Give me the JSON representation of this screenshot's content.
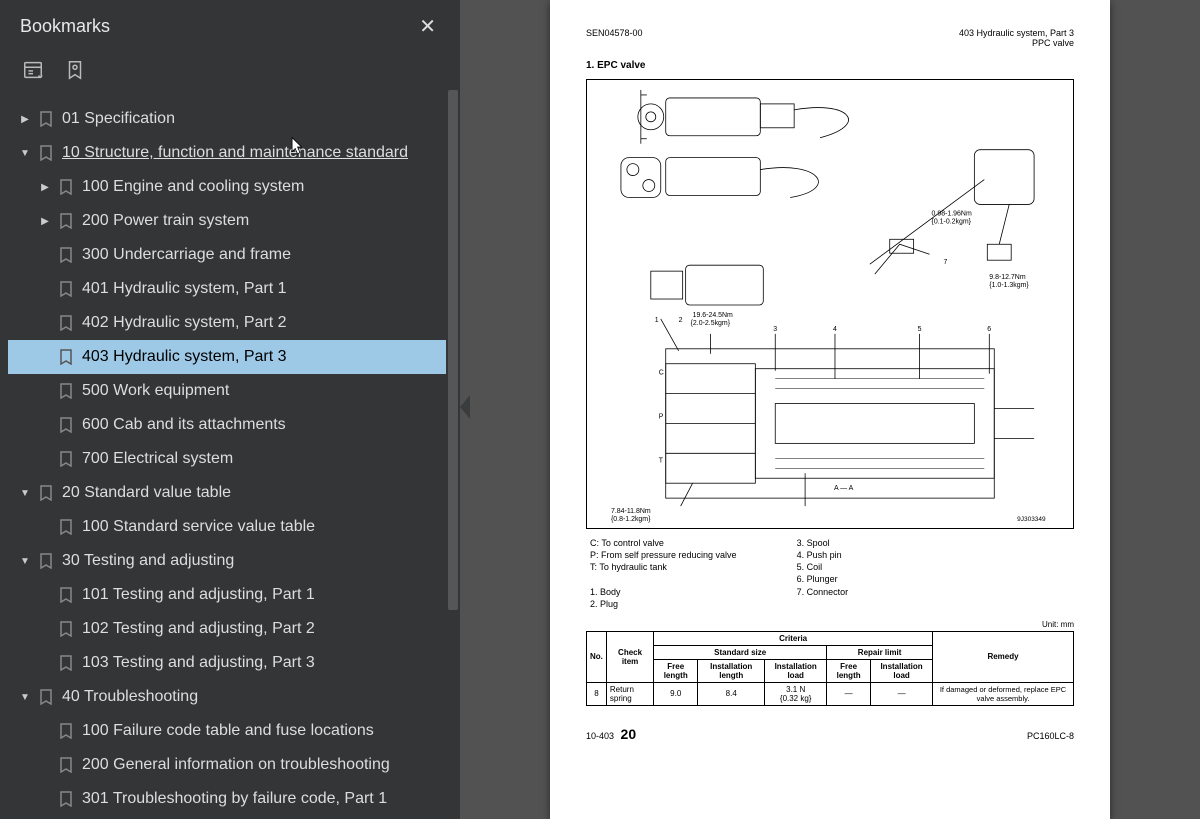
{
  "sidebar": {
    "title": "Bookmarks",
    "tree": [
      {
        "depth": 0,
        "chev": "right",
        "label": "01 Specification"
      },
      {
        "depth": 0,
        "chev": "down",
        "label": "10 Structure, function and maintenance standard",
        "hover": true
      },
      {
        "depth": 1,
        "chev": "right",
        "label": "100 Engine and cooling system"
      },
      {
        "depth": 1,
        "chev": "right",
        "label": "200 Power train system"
      },
      {
        "depth": 1,
        "chev": "none",
        "label": "300 Undercarriage and frame"
      },
      {
        "depth": 1,
        "chev": "none",
        "label": "401 Hydraulic system, Part 1"
      },
      {
        "depth": 1,
        "chev": "none",
        "label": "402 Hydraulic system, Part 2"
      },
      {
        "depth": 1,
        "chev": "none",
        "label": "403 Hydraulic system, Part 3",
        "selected": true
      },
      {
        "depth": 1,
        "chev": "none",
        "label": "500 Work equipment"
      },
      {
        "depth": 1,
        "chev": "none",
        "label": "600 Cab and its attachments"
      },
      {
        "depth": 1,
        "chev": "none",
        "label": "700 Electrical system"
      },
      {
        "depth": 0,
        "chev": "down",
        "label": "20 Standard value table"
      },
      {
        "depth": 1,
        "chev": "none",
        "label": "100 Standard service value table"
      },
      {
        "depth": 0,
        "chev": "down",
        "label": "30 Testing and adjusting"
      },
      {
        "depth": 1,
        "chev": "none",
        "label": "101 Testing and adjusting, Part 1"
      },
      {
        "depth": 1,
        "chev": "none",
        "label": "102 Testing and adjusting, Part 2"
      },
      {
        "depth": 1,
        "chev": "none",
        "label": "103 Testing and adjusting, Part 3"
      },
      {
        "depth": 0,
        "chev": "down",
        "label": "40 Troubleshooting"
      },
      {
        "depth": 1,
        "chev": "none",
        "label": "100 Failure code table and fuse locations"
      },
      {
        "depth": 1,
        "chev": "none",
        "label": "200 General information on troubleshooting"
      },
      {
        "depth": 1,
        "chev": "none",
        "label": "301 Troubleshooting by failure code, Part 1"
      }
    ]
  },
  "page": {
    "doc_id": "SEN04578-00",
    "section_right1": "403 Hydraulic system, Part 3",
    "section_right2": "PPC valve",
    "heading": "1.   EPC valve",
    "diagram_labels": {
      "torque1": "0.98-1.96Nm\n{0.1-0.2kgm}",
      "torque2": "9.8-12.7Nm\n{1.0-1.3kgm}",
      "torque3": "19.6-24.5Nm\n{2.0-2.5kgm}",
      "torque4": "7.84-11.8Nm\n{0.8-1.2kgm}",
      "section_mark": "A — A",
      "fig_id": "9J303349",
      "callouts": [
        "1",
        "2",
        "3",
        "4",
        "5",
        "6",
        "7"
      ],
      "ports": [
        "C",
        "P",
        "T"
      ]
    },
    "legend_left": [
      "C:   To control valve",
      "P:   From self pressure reducing valve",
      "T:   To hydraulic tank",
      "",
      "1.   Body",
      "2.   Plug"
    ],
    "legend_right": [
      "3.   Spool",
      "4.   Push pin",
      "5.   Coil",
      "6.   Plunger",
      "7.   Connector"
    ],
    "unit_note": "Unit: mm",
    "table": {
      "headers": {
        "no": "No.",
        "check": "Check item",
        "criteria": "Criteria",
        "std_size": "Standard size",
        "repair": "Repair limit",
        "remedy": "Remedy",
        "free_len": "Free length",
        "inst_len": "Installation length",
        "inst_load": "Installation load"
      },
      "row": {
        "no": "8",
        "check": "Return spring",
        "free_len": "9.0",
        "inst_len": "8.4",
        "inst_load": "3.1 N\n{0.32 kg}",
        "free_len2": "—",
        "inst_load2": "—",
        "remedy": "If damaged or deformed, replace EPC valve assembly."
      }
    },
    "footer_left_small": "10-403",
    "footer_left_big": "20",
    "footer_right": "PC160LC-8"
  }
}
